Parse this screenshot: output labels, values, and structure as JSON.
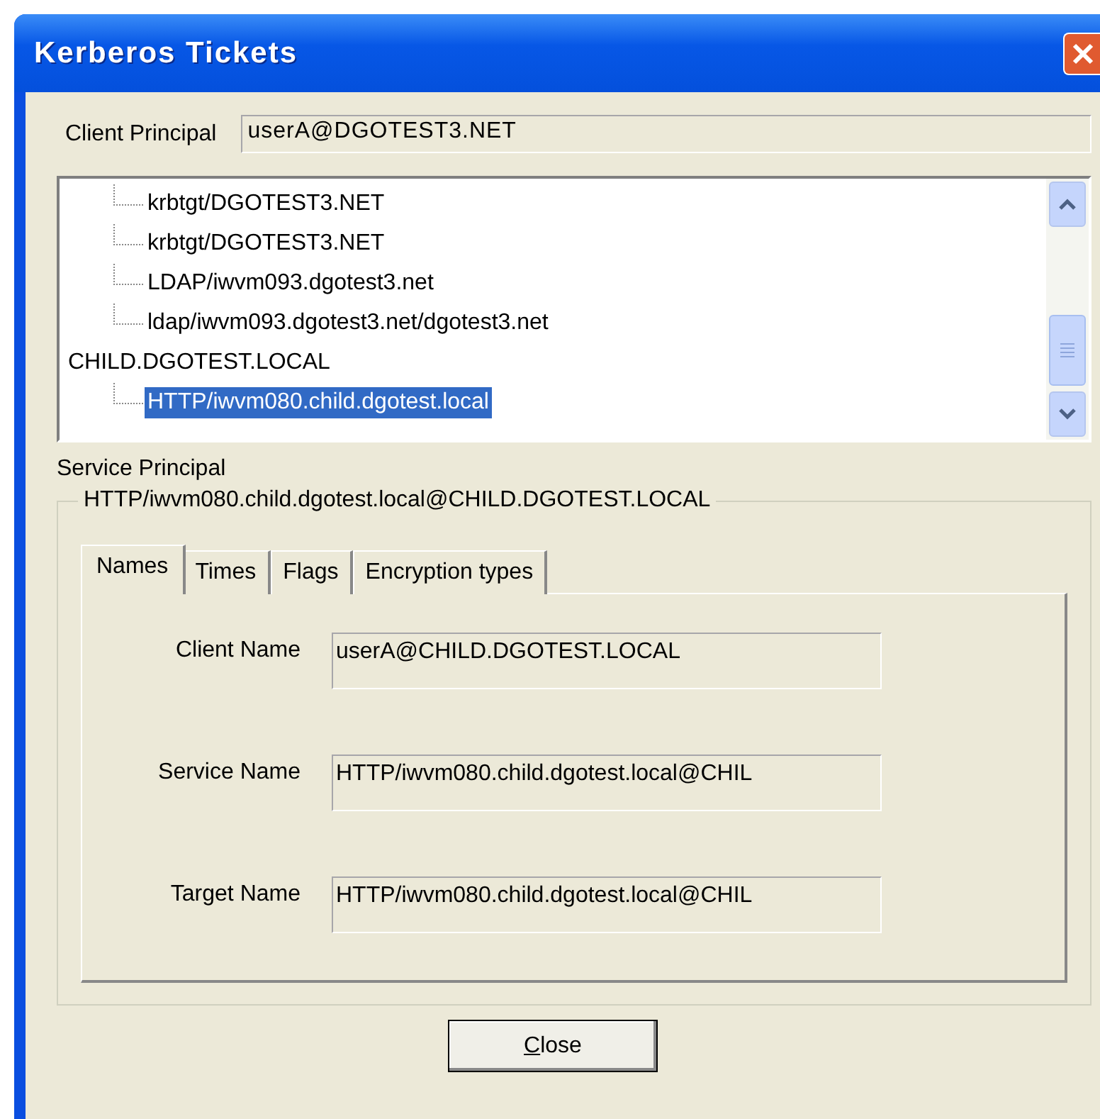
{
  "window": {
    "title": "Kerberos Tickets"
  },
  "client_principal": {
    "label": "Client Principal",
    "value": "userA@DGOTEST3.NET"
  },
  "tree": {
    "items": [
      {
        "children": [
          {
            "label": "krbtgt/DGOTEST3.NET",
            "selected": false
          },
          {
            "label": "krbtgt/DGOTEST3.NET",
            "selected": false
          },
          {
            "label": "LDAP/iwvm093.dgotest3.net",
            "selected": false
          },
          {
            "label": "ldap/iwvm093.dgotest3.net/dgotest3.net",
            "selected": false
          }
        ]
      },
      {
        "label": "CHILD.DGOTEST.LOCAL",
        "selected": false,
        "children": [
          {
            "label": "HTTP/iwvm080.child.dgotest.local",
            "selected": true
          }
        ]
      }
    ]
  },
  "service_principal": {
    "label": "Service Principal",
    "group_title": "HTTP/iwvm080.child.dgotest.local@CHILD.DGOTEST.LOCAL"
  },
  "tabs": [
    {
      "label": "Names",
      "selected": true
    },
    {
      "label": "Times",
      "selected": false
    },
    {
      "label": "Flags",
      "selected": false
    },
    {
      "label": "Encryption types",
      "selected": false
    }
  ],
  "fields": [
    {
      "label": "Client Name",
      "value": "userA@CHILD.DGOTEST.LOCAL"
    },
    {
      "label": "Service Name",
      "value": "HTTP/iwvm080.child.dgotest.local@CHIL"
    },
    {
      "label": "Target Name",
      "value": "HTTP/iwvm080.child.dgotest.local@CHIL"
    }
  ],
  "buttons": [
    {
      "label": "Close"
    }
  ]
}
